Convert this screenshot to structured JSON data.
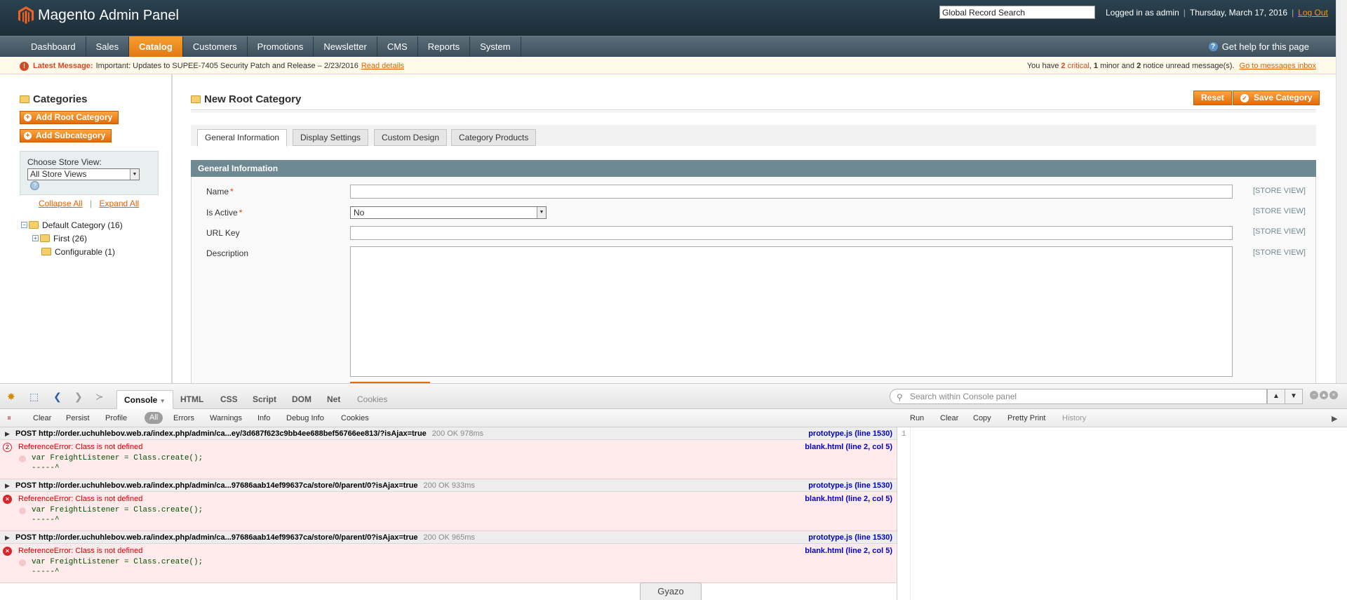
{
  "header": {
    "logo_text": "Magento",
    "logo_sub": "Admin Panel",
    "search_value": "Global Record Search",
    "logged_in": "Logged in as admin",
    "date": "Thursday, March 17, 2016",
    "logout": "Log Out"
  },
  "nav": {
    "items": [
      "Dashboard",
      "Sales",
      "Catalog",
      "Customers",
      "Promotions",
      "Newsletter",
      "CMS",
      "Reports",
      "System"
    ],
    "active": "Catalog",
    "help": "Get help for this page"
  },
  "message": {
    "label": "Latest Message:",
    "text": "Important: Updates to SUPEE-7405 Security Patch and Release – 2/23/2016",
    "link": "Read details",
    "right_prefix": "You have",
    "critical_count": "2",
    "critical_label": "critical",
    "minor_count": "1",
    "minor_label": "minor and",
    "notice_count": "2",
    "notice_label": "notice unread message(s).",
    "inbox_link": "Go to messages inbox"
  },
  "sidebar": {
    "title": "Categories",
    "add_root": "Add Root Category",
    "add_sub": "Add Subcategory",
    "store_label": "Choose Store View:",
    "store_value": "All Store Views",
    "collapse": "Collapse All",
    "expand": "Expand All",
    "sep": "|",
    "tree": [
      {
        "label": "Default Category (16)"
      },
      {
        "label": "First (26)"
      },
      {
        "label": "Configurable (1)"
      }
    ]
  },
  "main": {
    "title": "New Root Category",
    "reset": "Reset",
    "save": "Save Category",
    "tabs": [
      "General Information",
      "Display Settings",
      "Custom Design",
      "Category Products"
    ],
    "section": "General Information",
    "fields": {
      "name": "Name",
      "is_active": "Is Active",
      "is_active_value": "No",
      "url_key": "URL Key",
      "description": "Description",
      "required_mark": "*",
      "scope": "[STORE VIEW]"
    }
  },
  "firebug": {
    "tabs": [
      "Console",
      "HTML",
      "CSS",
      "Script",
      "DOM",
      "Net",
      "Cookies"
    ],
    "active_tab": "Console",
    "search_placeholder": "Search within Console panel",
    "toolbar": [
      "Clear",
      "Persist",
      "Profile",
      "All",
      "Errors",
      "Warnings",
      "Info",
      "Debug Info",
      "Cookies"
    ],
    "right_toolbar": [
      "Run",
      "Clear",
      "Copy",
      "Pretty Print",
      "History"
    ],
    "line_number": "1",
    "requests": [
      {
        "url": "POST http://order.uchuhlebov.web.ra/index.php/admin/ca...ey/3d687f623c9bb4ee688bef56766ee813/?isAjax=true",
        "status": "200 OK 978ms",
        "source": "prototype.js (line 1530)",
        "error_count": "2",
        "error": "ReferenceError: Class is not defined",
        "error_source": "blank.html (line 2, col 5)",
        "code": "var FreightListener = Class.create();",
        "caret": "-----^"
      },
      {
        "url": "POST http://order.uchuhlebov.web.ra/index.php/admin/ca...97686aab14ef99637ca/store/0/parent/0?isAjax=true",
        "status": "200 OK 933ms",
        "source": "prototype.js (line 1530)",
        "error_count": "×",
        "error": "ReferenceError: Class is not defined",
        "error_source": "blank.html (line 2, col 5)",
        "code": "var FreightListener = Class.create();",
        "caret": "-----^"
      },
      {
        "url": "POST http://order.uchuhlebov.web.ra/index.php/admin/ca...97686aab14ef99637ca/store/0/parent/0?isAjax=true",
        "status": "200 OK 965ms",
        "source": "prototype.js (line 1530)",
        "error_count": "×",
        "error": "ReferenceError: Class is not defined",
        "error_source": "blank.html (line 2, col 5)",
        "code": "var FreightListener = Class.create();",
        "caret": "-----^"
      }
    ]
  },
  "gyazo": "Gyazo",
  "colors": {
    "accent": "#eb5e00",
    "header": "#1c2d37",
    "section": "#6f8992",
    "error": "#d8242c"
  }
}
